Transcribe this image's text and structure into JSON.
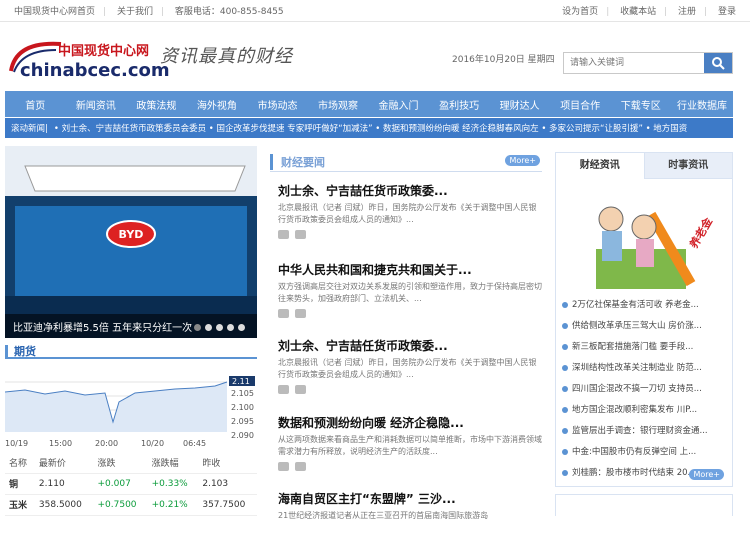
{
  "topbar": {
    "left": [
      "中国现货中心网首页",
      "关于我们",
      "客服电话：400-855-8455"
    ],
    "right": [
      "设为首页",
      "收藏本站",
      "注册",
      "登录"
    ]
  },
  "logo": {
    "cn": "中国现货中心网",
    "en": "chinabcec.com"
  },
  "slogan": "资讯最真的财经",
  "date": "2016年10月20日 星期四",
  "search": {
    "placeholder": "请输入关键词"
  },
  "nav": [
    "首页",
    "新闻资讯",
    "政策法规",
    "海外视角",
    "市场动态",
    "市场观察",
    "金融入门",
    "盈利技巧",
    "理财达人",
    "项目合作",
    "下载专区",
    "行业数据库"
  ],
  "ticker": {
    "label": "滚动新闻|",
    "text": "• 刘士余、宁吉喆任货币政策委员会委员 • 国企改革步伐提速 专家呼吁做好“加减法” • 数据和预测纷纷向暖 经济企稳脚春风向左 • 多家公司提示“让股引援” • 地方国资"
  },
  "slide": {
    "caption": "比亚迪净利暴增5.5倍 五年来只分红一次",
    "brand": "BYD"
  },
  "futures": {
    "title": "期货",
    "chart_last": "2.11",
    "yticks": [
      "2.105",
      "2.100",
      "2.095",
      "2.090"
    ],
    "xticks": [
      "10/19",
      "15:00",
      "20:00",
      "10/20",
      "06:45"
    ],
    "headers": [
      "名称",
      "最新价",
      "涨跌",
      "涨跌幅",
      "昨收"
    ],
    "rows": [
      [
        "铜",
        "2.110",
        "+0.007",
        "+0.33%",
        "2.103"
      ],
      [
        "玉米",
        "358.5000",
        "+0.7500",
        "+0.21%",
        "357.7500"
      ]
    ]
  },
  "news": {
    "title": "财经要闻",
    "more": "More+",
    "items": [
      {
        "h": "刘士余、宁吉喆任货币政策委...",
        "d": "北京晨报讯（记者 闫斌）昨日，国务院办公厅发布《关于调整中国人民银行货币政策委员会组成人员的通知》..."
      },
      {
        "h": "中华人民共和国和捷克共和国关于...",
        "d": "双方强调高层交往对双边关系发展的引领和塑造作用，致力于保持高层密切往来势头，加强政府部门、立法机关、..."
      },
      {
        "h": "刘士余、宁吉喆任货币政策委...",
        "d": "北京晨报讯（记者 闫斌）昨日，国务院办公厅发布《关于调整中国人民银行货币政策委员会组成人员的通知》..."
      },
      {
        "h": "数据和预测纷纷向暖 经济企稳隐...",
        "d": "从这两项数据来看商品生产和消耗数据可以简单推断，市场中下游消费领域需求潜力有所释放，说明经济生产的活跃度..."
      },
      {
        "h": "海南自贸区主打“东盟牌” 三沙...",
        "d": "21世纪经济报道记者从正在三亚召开的首届南海国际旅游岛"
      }
    ]
  },
  "right": {
    "tabs": [
      "财经资讯",
      "时事资讯"
    ],
    "illus_text": "养老金",
    "items": [
      "2万亿社保基金有活可收 养老金...",
      "供给侧改革承压三驾大山 房价涨...",
      "新三板配套措施落门槛 要手段...",
      "深圳结构性改革关注制造业 防范...",
      "四川国企混改不搞一刀切 支持员...",
      "地方国企混改顺利密集发布 川P...",
      "监管层出手调查：银行理财资金通...",
      "中金:中国股市仍有反弹空间 上...",
      "刘桂鹏：股市楼市时代结束 20..."
    ],
    "more": "More+"
  }
}
